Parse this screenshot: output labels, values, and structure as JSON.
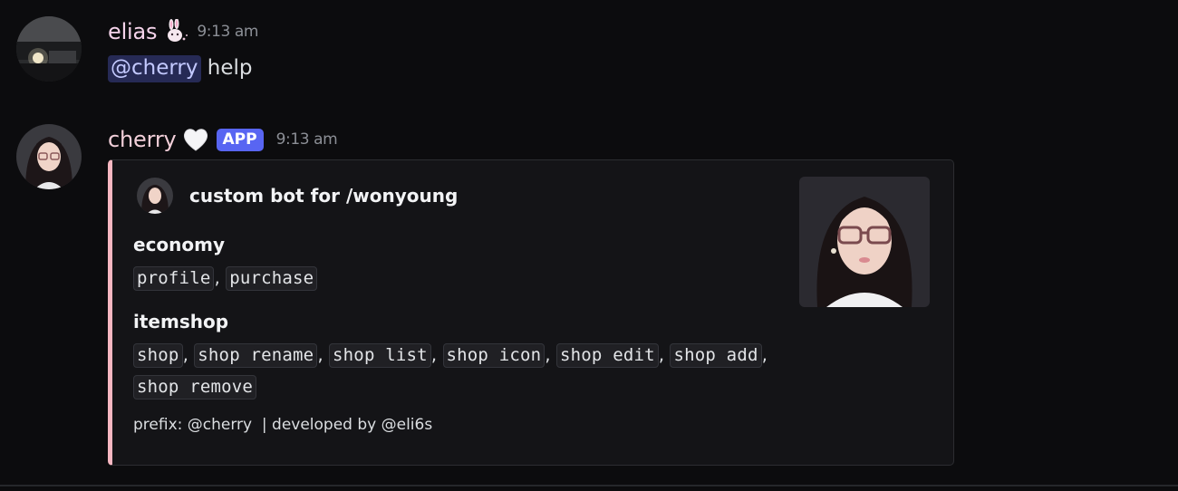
{
  "messages": [
    {
      "username": "elias",
      "timestamp": "9:13 am",
      "mention": "@cherry",
      "text": " help",
      "emoji": "bunny-emoji"
    },
    {
      "username": "cherry",
      "timestamp": "9:13 am",
      "app_tag": "APP",
      "emoji": "white-heart-emoji",
      "embed": {
        "accent_color": "#f7b7c1",
        "author": "custom bot for /wonyoung",
        "fields": [
          {
            "name": "economy",
            "commands": [
              "profile",
              "purchase"
            ]
          },
          {
            "name": "itemshop",
            "commands": [
              "shop",
              "shop rename",
              "shop list",
              "shop icon",
              "shop edit",
              "shop add",
              "shop remove"
            ]
          }
        ],
        "footer": "prefix: @cherry  | developed by @eli6s"
      }
    }
  ],
  "colors": {
    "background": "#0c0c0e",
    "mention_bg": "#262a55",
    "app_tag": "#5865f2"
  }
}
